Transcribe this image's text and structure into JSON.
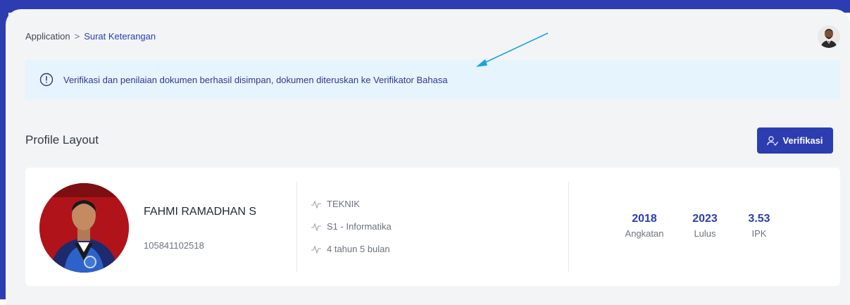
{
  "breadcrumb": {
    "root": "Application",
    "separator": ">",
    "current": "Surat Keterangan"
  },
  "alert": {
    "icon": "info-circle-icon",
    "message": "Verifikasi dan penilaian dokumen berhasil disimpan, dokumen diteruskan ke Verifikator Bahasa"
  },
  "section": {
    "title": "Profile Layout"
  },
  "actions": {
    "verify_label": "Verifikasi",
    "verify_icon": "user-check-icon"
  },
  "profile": {
    "name": "FAHMI RAMADHAN S",
    "nim": "105841102518",
    "info": [
      {
        "icon": "pulse-icon",
        "text": "TEKNIK"
      },
      {
        "icon": "pulse-icon",
        "text": "S1 - Informatika"
      },
      {
        "icon": "pulse-icon",
        "text": "4 tahun 5 bulan"
      }
    ],
    "stats": [
      {
        "value": "2018",
        "label": "Angkatan"
      },
      {
        "value": "2023",
        "label": "Lulus"
      },
      {
        "value": "3.53",
        "label": "IPK"
      }
    ]
  },
  "colors": {
    "primary": "#2b3db1",
    "alert_bg": "#e6f4fd",
    "annotation_arrow": "#1aa3dc"
  }
}
